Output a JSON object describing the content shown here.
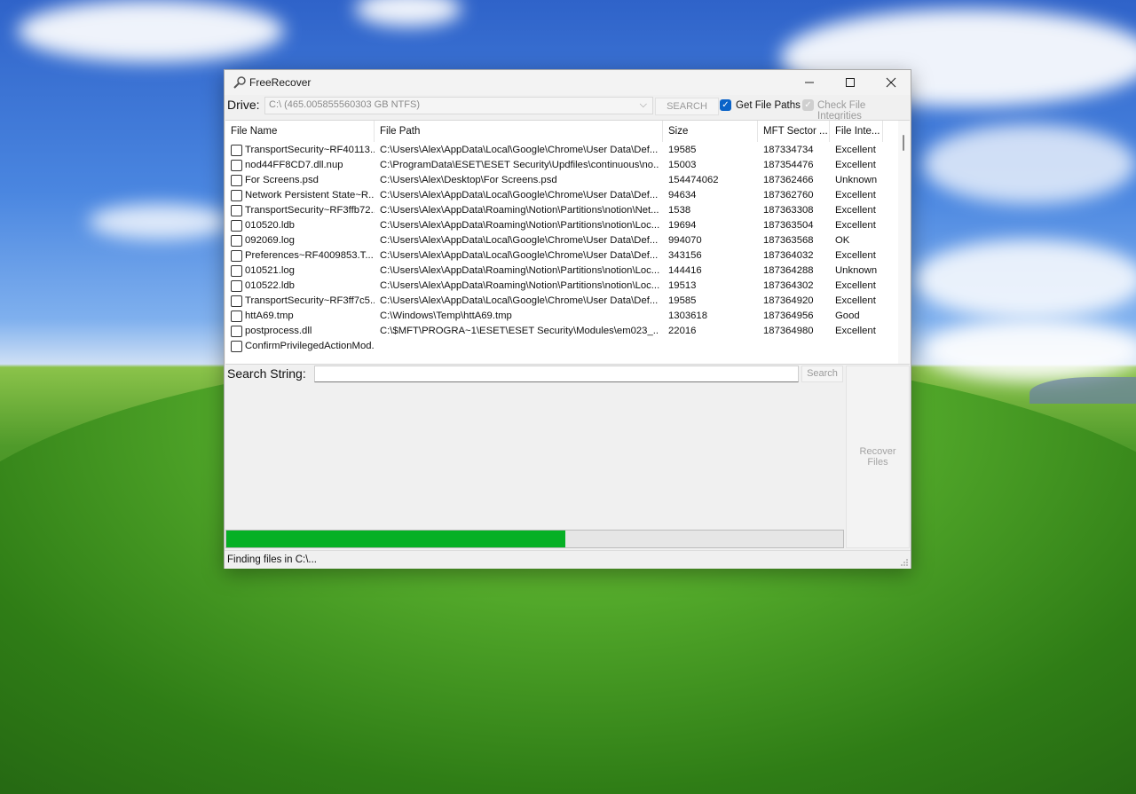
{
  "window": {
    "title": "FreeRecover",
    "controls": {
      "minimize": "–",
      "maximize": "☐",
      "close": "✕"
    }
  },
  "toolbar": {
    "drive_label": "Drive:",
    "drive_value": "C:\\ (465.005855560303 GB NTFS)",
    "search_button": "SEARCH",
    "get_file_paths": {
      "label": "Get File Paths",
      "checked": true
    },
    "check_integrities": {
      "label": "Check File Integrities",
      "checked": true,
      "disabled": true
    }
  },
  "table": {
    "columns": [
      "File Name",
      "File Path",
      "Size",
      "MFT Sector ...",
      "File Inte..."
    ],
    "rows": [
      [
        "TransportSecurity~RF40113...",
        "C:\\Users\\Alex\\AppData\\Local\\Google\\Chrome\\User Data\\Def...",
        "19585",
        "187334734",
        "Excellent"
      ],
      [
        "nod44FF8CD7.dll.nup",
        "C:\\ProgramData\\ESET\\ESET Security\\Updfiles\\continuous\\no...",
        "15003",
        "187354476",
        "Excellent"
      ],
      [
        "For Screens.psd",
        "C:\\Users\\Alex\\Desktop\\For Screens.psd",
        "154474062",
        "187362466",
        "Unknown"
      ],
      [
        "Network Persistent State~R...",
        "C:\\Users\\Alex\\AppData\\Local\\Google\\Chrome\\User Data\\Def...",
        "94634",
        "187362760",
        "Excellent"
      ],
      [
        "TransportSecurity~RF3ffb72...",
        "C:\\Users\\Alex\\AppData\\Roaming\\Notion\\Partitions\\notion\\Net...",
        "1538",
        "187363308",
        "Excellent"
      ],
      [
        "010520.ldb",
        "C:\\Users\\Alex\\AppData\\Roaming\\Notion\\Partitions\\notion\\Loc...",
        "19694",
        "187363504",
        "Excellent"
      ],
      [
        "092069.log",
        "C:\\Users\\Alex\\AppData\\Local\\Google\\Chrome\\User Data\\Def...",
        "994070",
        "187363568",
        "OK"
      ],
      [
        "Preferences~RF4009853.T...",
        "C:\\Users\\Alex\\AppData\\Local\\Google\\Chrome\\User Data\\Def...",
        "343156",
        "187364032",
        "Excellent"
      ],
      [
        "010521.log",
        "C:\\Users\\Alex\\AppData\\Roaming\\Notion\\Partitions\\notion\\Loc...",
        "144416",
        "187364288",
        "Unknown"
      ],
      [
        "010522.ldb",
        "C:\\Users\\Alex\\AppData\\Roaming\\Notion\\Partitions\\notion\\Loc...",
        "19513",
        "187364302",
        "Excellent"
      ],
      [
        "TransportSecurity~RF3ff7c5...",
        "C:\\Users\\Alex\\AppData\\Local\\Google\\Chrome\\User Data\\Def...",
        "19585",
        "187364920",
        "Excellent"
      ],
      [
        "httA69.tmp",
        "C:\\Windows\\Temp\\httA69.tmp",
        "1303618",
        "187364956",
        "Good"
      ],
      [
        "postprocess.dll",
        "C:\\$MFT\\PROGRA~1\\ESET\\ESET Security\\Modules\\em023_...",
        "22016",
        "187364980",
        "Excellent"
      ],
      [
        "ConfirmPrivilegedActionMod...",
        "",
        "",
        "",
        ""
      ]
    ]
  },
  "search": {
    "label": "Search String:",
    "value": "",
    "button": "Search"
  },
  "recover_button": "Recover Files",
  "progress": {
    "fraction": 0.55
  },
  "status": "Finding files in C:\\...",
  "colors": {
    "progress": "#06b025",
    "checkbox_accent": "#0a63c8"
  }
}
